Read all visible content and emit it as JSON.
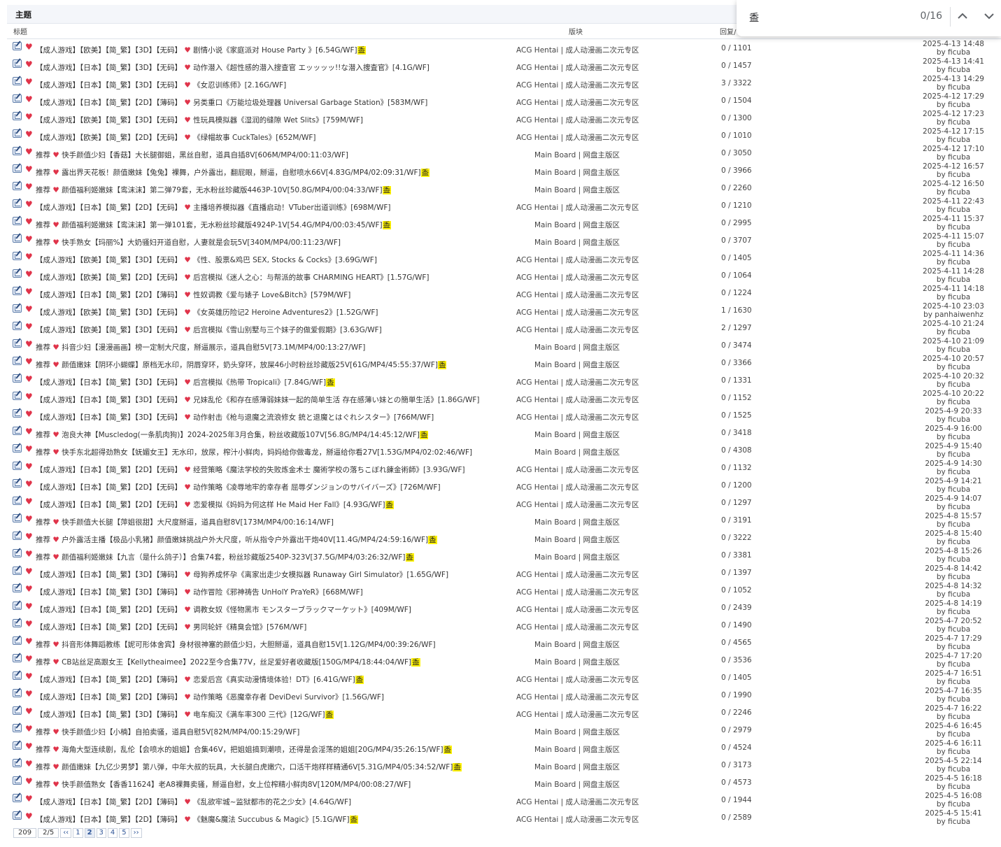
{
  "header": {
    "section_title": "主题",
    "col_title": "标题",
    "col_board": "版块",
    "col_stats": "回复/"
  },
  "find_bar": {
    "query": "盉",
    "count": "0/16"
  },
  "colors": {
    "heart": "#e0344a",
    "highlight": "#fff200",
    "link": "#2f5597"
  },
  "threads": [
    {
      "prefix": "【成人游戏】【欧美】【简_繁】【3D】【无码】",
      "body": "剧情小说《家庭派对 House Party 》[6.54G/WF]",
      "mark": "盉",
      "board": "ACG Hentai | 成人动漫画二次元专区",
      "stats": "0 / 1101",
      "time": "2025-4-13 14:48",
      "by": "by ficuba"
    },
    {
      "prefix": "【成人游戏】【日本】【简_繁】【3D】【无码】",
      "body": "动作潜入《超性感的潜入搜查官 エッッッッ!!な潜入捜査官》[4.1G/WF]",
      "mark": "",
      "board": "ACG Hentai | 成人动漫画二次元专区",
      "stats": "0 / 1457",
      "time": "2025-4-13 14:41",
      "by": "by ficuba"
    },
    {
      "prefix": "【成人游戏】【日本】【简_繁】【3D】【无码】",
      "body": "《女忍训练师》[2.16G/WF]",
      "mark": "",
      "board": "ACG Hentai | 成人动漫画二次元专区",
      "stats": "3 / 3322",
      "time": "2025-4-13 14:29",
      "by": "by ficuba"
    },
    {
      "prefix": "【成人游戏】【日本】【简_繁】【2D】【薄码】",
      "body": "另类重口《万能垃圾处理器 Universal Garbage Station》[583M/WF]",
      "mark": "",
      "board": "ACG Hentai | 成人动漫画二次元专区",
      "stats": "0 / 1504",
      "time": "2025-4-12 17:29",
      "by": "by ficuba"
    },
    {
      "prefix": "【成人游戏】【欧美】【简_繁】【3D】【无码】",
      "body": "性玩具模拟器《湿润的缝隙 Wet Slits》[759M/WF]",
      "mark": "",
      "board": "ACG Hentai | 成人动漫画二次元专区",
      "stats": "0 / 1300",
      "time": "2025-4-12 17:23",
      "by": "by ficuba"
    },
    {
      "prefix": "【成人游戏】【欧美】【简_繁】【2D】【无码】",
      "body": "《绿帽故事 CuckTales》[652M/WF]",
      "mark": "",
      "board": "ACG Hentai | 成人动漫画二次元专区",
      "stats": "0 / 1010",
      "time": "2025-4-12 17:15",
      "by": "by ficuba"
    },
    {
      "prefix": "推荐",
      "body": "快手颜值少妇【香菇】大长腿御姐，黑丝自慰，道具自插8V[606M/MP4/00:11:03/WF]",
      "mark": "",
      "board": "Main Board | 网盘主版区",
      "stats": "0 / 3050",
      "time": "2025-4-12 17:10",
      "by": "by ficuba"
    },
    {
      "prefix": "推荐",
      "body": "露出界天花板！颜值嫩妹【兔兔】裸舞，户外露出，翻屁眼，掰逼，自慰喷水66V[4.83G/MP4/02:09:31/WF]",
      "mark": "盉",
      "board": "Main Board | 网盘主版区",
      "stats": "0 / 3966",
      "time": "2025-4-12 16:57",
      "by": "by ficuba"
    },
    {
      "prefix": "推荐",
      "body": "颜值福利姬嫩妹【鸾沫沫】第二弹79套，无水粉丝珍藏版4463P-10V[50.8G/MP4/00:04:33/WF]",
      "mark": "盉",
      "board": "Main Board | 网盘主版区",
      "stats": "0 / 2260",
      "time": "2025-4-12 16:50",
      "by": "by ficuba"
    },
    {
      "prefix": "【成人游戏】【日本】【简_繁】【2D】【无码】",
      "body": "主播培养模拟器《直播启动！VTuber出道训练》[698M/WF]",
      "mark": "",
      "board": "ACG Hentai | 成人动漫画二次元专区",
      "stats": "0 / 1210",
      "time": "2025-4-11 22:43",
      "by": "by ficuba"
    },
    {
      "prefix": "推荐",
      "body": "颜值福利姬嫩妹【鸾沫沫】第一弹101套，无水粉丝珍藏版4924P-1V[54.4G/MP4/00:03:45/WF]",
      "mark": "盉",
      "board": "Main Board | 网盘主版区",
      "stats": "0 / 2995",
      "time": "2025-4-11 15:37",
      "by": "by ficuba"
    },
    {
      "prefix": "推荐",
      "body": "快手熟女【玛丽%】大奶骚妇开道自慰，人妻就是会玩5V[340M/MP4/00:11:23/WF]",
      "mark": "",
      "board": "Main Board | 网盘主版区",
      "stats": "0 / 3707",
      "time": "2025-4-11 15:07",
      "by": "by ficuba"
    },
    {
      "prefix": "【成人游戏】【欧美】【简_繁】【3D】【无码】",
      "body": "《性、股票&鸡巴 SEX, Stocks & Cocks》[3.69G/WF]",
      "mark": "",
      "board": "ACG Hentai | 成人动漫画二次元专区",
      "stats": "0 / 1405",
      "time": "2025-4-11 14:36",
      "by": "by ficuba"
    },
    {
      "prefix": "【成人游戏】【欧美】【简_繁】【2D】【无码】",
      "body": "后宫模拟《迷人之心：与帮派的故事 CHARMING HEART》[1.57G/WF]",
      "mark": "",
      "board": "ACG Hentai | 成人动漫画二次元专区",
      "stats": "0 / 1064",
      "time": "2025-4-11 14:28",
      "by": "by ficuba"
    },
    {
      "prefix": "【成人游戏】【日本】【简_繁】【2D】【薄码】",
      "body": "性奴调教《爱与婊子 Love&Bitch》[579M/WF]",
      "mark": "",
      "board": "ACG Hentai | 成人动漫画二次元专区",
      "stats": "0 / 1224",
      "time": "2025-4-11 14:18",
      "by": "by ficuba"
    },
    {
      "prefix": "【成人游戏】【欧美】【简_繁】【3D】【无码】",
      "body": "《女英雄历险记2 Heroine Adventures2》[1.52G/WF]",
      "mark": "",
      "board": "ACG Hentai | 成人动漫画二次元专区",
      "stats": "1 / 1630",
      "time": "2025-4-10 23:03",
      "by": "by panhaiwenhz"
    },
    {
      "prefix": "【成人游戏】【欧美】【简_繁】【3D】【无码】",
      "body": "后宫模拟《雪山别墅与三个妹子的做爱假期》[3.63G/WF]",
      "mark": "",
      "board": "ACG Hentai | 成人动漫画二次元专区",
      "stats": "2 / 1297",
      "time": "2025-4-10 21:24",
      "by": "by ficuba"
    },
    {
      "prefix": "推荐",
      "body": "抖音少妇【漫漫画画】榜一定制大尺度，掰逼展示，道具自慰5V[73.1M/MP4/00:13:27/WF]",
      "mark": "",
      "board": "Main Board | 网盘主版区",
      "stats": "0 / 3474",
      "time": "2025-4-10 21:09",
      "by": "by ficuba"
    },
    {
      "prefix": "推荐",
      "body": "颜值嫩妹【阴环小蝴蝶】原档无水印，阴唇穿环，奶头穿环，放屎46小时粉丝珍藏版25V[61G/MP4/45:55:37/WF]",
      "mark": "盉",
      "board": "Main Board | 网盘主版区",
      "stats": "0 / 3366",
      "time": "2025-4-10 20:57",
      "by": "by ficuba"
    },
    {
      "prefix": "【成人游戏】【日本】【简_繁】【3D】【无码】",
      "body": "后宫模拟《热带 Tropicali》[7.84G/WF]",
      "mark": "盉",
      "board": "ACG Hentai | 成人动漫画二次元专区",
      "stats": "0 / 1331",
      "time": "2025-4-10 20:32",
      "by": "by ficuba"
    },
    {
      "prefix": "【成人游戏】【日本】【简_繁】【3D】【无码】",
      "body": "兄妹乱伦《和存在感薄弱妹妹一起的简单生活 存在感薄い妹との簡単生活》[1.86G/WF]",
      "mark": "",
      "board": "ACG Hentai | 成人动漫画二次元专区",
      "stats": "0 / 1152",
      "time": "2025-4-10 20:22",
      "by": "by ficuba"
    },
    {
      "prefix": "【成人游戏】【日本】【简_繁】【3D】【无码】",
      "body": "动作射击《枪与退魔之流浪修女 銃と退魔とはぐれシスター》[766M/WF]",
      "mark": "",
      "board": "ACG Hentai | 成人动漫画二次元专区",
      "stats": "0 / 1525",
      "time": "2025-4-9 20:33",
      "by": "by ficuba"
    },
    {
      "prefix": "推荐",
      "body": "泡良大神【Muscledog(一条肌肉狗)】2024-2025年3月合集，粉丝收藏版107V[56.8G/MP4/14:45:12/WF]",
      "mark": "盉",
      "board": "Main Board | 网盘主版区",
      "stats": "0 / 3418",
      "time": "2025-4-9 16:00",
      "by": "by ficuba"
    },
    {
      "prefix": "推荐",
      "body": "快手东北超得劲熟女【妩媚女王】无水印，放尿，榨汁小鲜肉，妈妈给你做毒龙，掰逼给你看27V[1.53G/MP4/02:02:46/WF]",
      "mark": "",
      "board": "Main Board | 网盘主版区",
      "stats": "0 / 4308",
      "time": "2025-4-9 15:40",
      "by": "by ficuba"
    },
    {
      "prefix": "【成人游戏】【日本】【简_繁】【2D】【无码】",
      "body": "经营策略《魔法学校的失败炼金术士 魔術学校の落ちこぼれ錬金術師》[3.93G/WF]",
      "mark": "",
      "board": "ACG Hentai | 成人动漫画二次元专区",
      "stats": "0 / 1132",
      "time": "2025-4-9 14:30",
      "by": "by ficuba"
    },
    {
      "prefix": "【成人游戏】【日本】【简_繁】【2D】【无码】",
      "body": "动作策略《凌辱地牢的幸存者 屈辱ダンジョンのサバイバーズ》[726M/WF]",
      "mark": "",
      "board": "ACG Hentai | 成人动漫画二次元专区",
      "stats": "0 / 1200",
      "time": "2025-4-9 14:21",
      "by": "by ficuba"
    },
    {
      "prefix": "【成人游戏】【日本】【简_繁】【2D】【无码】",
      "body": "恋爱模拟《妈妈为何这样 He Maid Her Fall》[4.93G/WF]",
      "mark": "盉",
      "board": "ACG Hentai | 成人动漫画二次元专区",
      "stats": "0 / 1297",
      "time": "2025-4-9 14:07",
      "by": "by ficuba"
    },
    {
      "prefix": "推荐",
      "body": "快手颜值大长腿【萍姐很甜】大尺度掰逼，道具自慰8V[173M/MP4/00:16:14/WF]",
      "mark": "",
      "board": "Main Board | 网盘主版区",
      "stats": "0 / 3191",
      "time": "2025-4-8 15:57",
      "by": "by ficuba"
    },
    {
      "prefix": "推荐",
      "body": "户外露活主播【极品小乳猪】颜值嫩妹挑战户外大尺度，听从指令户外露出干炮40V[11.4G/MP4/24:59:16/WF]",
      "mark": "盉",
      "board": "Main Board | 网盘主版区",
      "stats": "0 / 3222",
      "time": "2025-4-8 15:40",
      "by": "by ficuba"
    },
    {
      "prefix": "推荐",
      "body": "颜值福利姬嫩妹【九言（是什么鸽子）】合集74套，粉丝珍藏版2540P-323V[37.5G/MP4/03:26:32/WF]",
      "mark": "盉",
      "board": "Main Board | 网盘主版区",
      "stats": "0 / 3381",
      "time": "2025-4-8 15:26",
      "by": "by ficuba"
    },
    {
      "prefix": "【成人游戏】【日本】【简_繁】【3D】【薄码】",
      "body": "母狗养成怀孕《离家出走少女模拟器 Runaway Girl Simulator》[1.65G/WF]",
      "mark": "",
      "board": "ACG Hentai | 成人动漫画二次元专区",
      "stats": "0 / 1397",
      "time": "2025-4-8 14:42",
      "by": "by ficuba"
    },
    {
      "prefix": "【成人游戏】【日本】【简_繁】【3D】【薄码】",
      "body": "动作冒险《邪神祷告 UnHolY PraYeR》[668M/WF]",
      "mark": "",
      "board": "ACG Hentai | 成人动漫画二次元专区",
      "stats": "0 / 1052",
      "time": "2025-4-8 14:32",
      "by": "by ficuba"
    },
    {
      "prefix": "【成人游戏】【日本】【简_繁】【2D】【无码】",
      "body": "调教女奴《怪物黑市 モンスターブラックマーケット》[409M/WF]",
      "mark": "",
      "board": "ACG Hentai | 成人动漫画二次元专区",
      "stats": "0 / 2439",
      "time": "2025-4-8 14:19",
      "by": "by ficuba"
    },
    {
      "prefix": "【成人游戏】【日本】【简_繁】【2D】【无码】",
      "body": "男同轮奸《精臭会馆》[576M/WF]",
      "mark": "",
      "board": "ACG Hentai | 成人动漫画二次元专区",
      "stats": "0 / 1490",
      "time": "2025-4-7 20:52",
      "by": "by ficuba"
    },
    {
      "prefix": "推荐",
      "body": "抖音形体舞蹈教练【妮可形体舍宾】身材很神塞的颜值少妇，大胆掰逼，道具自慰15V[1.12G/MP4/00:39:26/WF]",
      "mark": "",
      "board": "Main Board | 网盘主版区",
      "stats": "0 / 4565",
      "time": "2025-4-7 17:29",
      "by": "by ficuba"
    },
    {
      "prefix": "推荐",
      "body": "CB站丝足高跟女王【Kellytheaimee】2022至今合集77V，丝足爱好者收藏版[150G/MP4/18:44:04/WF]",
      "mark": "盉",
      "board": "Main Board | 网盘主版区",
      "stats": "0 / 3536",
      "time": "2025-4-7 17:20",
      "by": "by ficuba"
    },
    {
      "prefix": "【成人游戏】【日本】【简_繁】【2D】【薄码】",
      "body": "恋爱后宫《真实动漫情境体验！DT》[6.41G/WF]",
      "mark": "盉",
      "board": "ACG Hentai | 成人动漫画二次元专区",
      "stats": "0 / 1405",
      "time": "2025-4-7 16:51",
      "by": "by ficuba"
    },
    {
      "prefix": "【成人游戏】【日本】【简_繁】【2D】【薄码】",
      "body": "动作策略《恶魔幸存者 DeviDevi Survivor》[1.56G/WF]",
      "mark": "",
      "board": "ACG Hentai | 成人动漫画二次元专区",
      "stats": "0 / 1990",
      "time": "2025-4-7 16:35",
      "by": "by ficuba"
    },
    {
      "prefix": "【成人游戏】【日本】【简_繁】【3D】【薄码】",
      "body": "电车痴汉《满车率300 三代》[12G/WF]",
      "mark": "盉",
      "board": "ACG Hentai | 成人动漫画二次元专区",
      "stats": "0 / 2246",
      "time": "2025-4-7 16:22",
      "by": "by ficuba"
    },
    {
      "prefix": "推荐",
      "body": "快手颜值少妇【小楠】自拍卖骚，道具自慰5V[82M/MP4/00:15:29/WF]",
      "mark": "",
      "board": "Main Board | 网盘主版区",
      "stats": "0 / 2979",
      "time": "2025-4-6 16:45",
      "by": "by ficuba"
    },
    {
      "prefix": "推荐",
      "body": "海角大型连续剧，乱伦【会喷水的姐姐】合集46V，把姐姐搞到潮喷，还得是会淫荡的姐姐[20G/MP4/35:26:15/WF]",
      "mark": "盉",
      "board": "Main Board | 网盘主版区",
      "stats": "0 / 4524",
      "time": "2025-4-6 16:11",
      "by": "by ficuba"
    },
    {
      "prefix": "推荐",
      "body": "颜值嫩妹【九亿少男梦】第八弹，中年大叔的玩具，大长腿白虎嫩穴，口活干炮样样精通6V[5.31G/MP4/05:34:52/WF]",
      "mark": "盉",
      "board": "Main Board | 网盘主版区",
      "stats": "0 / 3173",
      "time": "2025-4-5 22:14",
      "by": "by ficuba"
    },
    {
      "prefix": "推荐",
      "body": "快手颜值熟女【香香11624】老A8裸舞卖骚，掰逼自慰，女上位榨精小鲜肉8V[120M/MP4/00:08:27/WF]",
      "mark": "",
      "board": "Main Board | 网盘主版区",
      "stats": "0 / 4573",
      "time": "2025-4-5 16:18",
      "by": "by ficuba"
    },
    {
      "prefix": "【成人游戏】【日本】【简_繁】【2D】【薄码】",
      "body": "《乱欲牢城~监狱都市的花之少女》[4.64G/WF]",
      "mark": "",
      "board": "ACG Hentai | 成人动漫画二次元专区",
      "stats": "0 / 1944",
      "time": "2025-4-5 16:08",
      "by": "by ficuba"
    },
    {
      "prefix": "【成人游戏】【日本】【简_繁】【2D】【薄码】",
      "body": "《魅魔&魔法 Succubus & Magic》[5.1G/WF]",
      "mark": "盉",
      "board": "ACG Hentai | 成人动漫画二次元专区",
      "stats": "0 / 2589",
      "time": "2025-4-5 15:41",
      "by": "by ficuba"
    }
  ],
  "pager": {
    "total": "209",
    "page_info": "2/5",
    "prev": "‹‹",
    "pages": [
      "1",
      "2",
      "3",
      "4",
      "5"
    ],
    "current": "2",
    "next": "››"
  }
}
